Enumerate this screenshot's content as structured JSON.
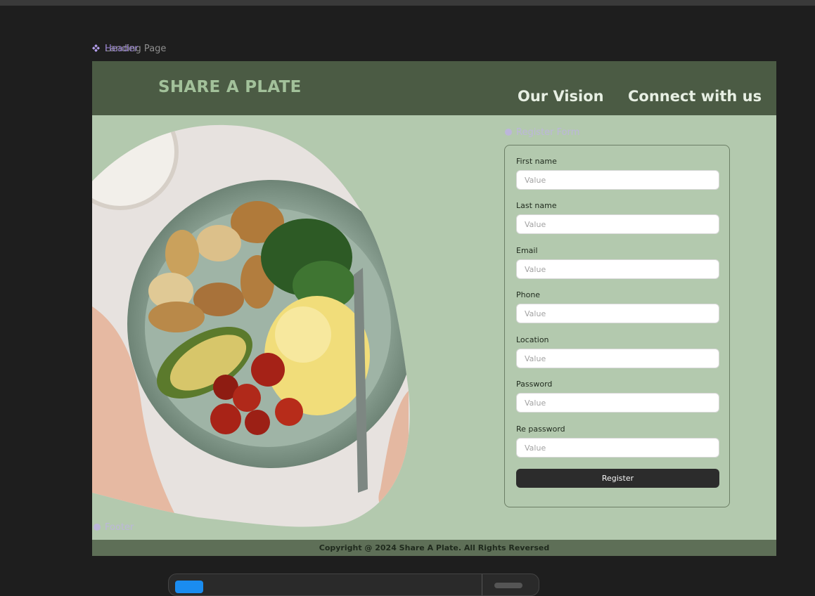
{
  "canvas_labels": {
    "frame_a": "Landing Page",
    "frame_b": "Header",
    "form": "Register Form",
    "footer": "Footer"
  },
  "header": {
    "brand": "SHARE A PLATE",
    "nav": [
      "Our Vision",
      "Connect with us"
    ]
  },
  "hero_image_alt": "Bowl with roasted potatoes, spinach, scrambled eggs, avocado and roasted tomatoes",
  "form": {
    "fields": [
      {
        "label": "First name",
        "placeholder": "Value"
      },
      {
        "label": "Last name",
        "placeholder": "Value"
      },
      {
        "label": "Email",
        "placeholder": "Value"
      },
      {
        "label": "Phone",
        "placeholder": "Value"
      },
      {
        "label": "Location",
        "placeholder": "Value"
      },
      {
        "label": "Password",
        "placeholder": "Value"
      },
      {
        "label": "Re password",
        "placeholder": "Value"
      }
    ],
    "submit_label": "Register"
  },
  "footer": {
    "text": "Copyright @ 2024 Share A Plate. All Rights Reversed"
  },
  "colors": {
    "page_bg": "#b3c9ae",
    "header_bg": "#4b5b44",
    "brand": "#a2c19a",
    "button": "#2c2c2c",
    "footer_bg": "#5e6f57"
  }
}
